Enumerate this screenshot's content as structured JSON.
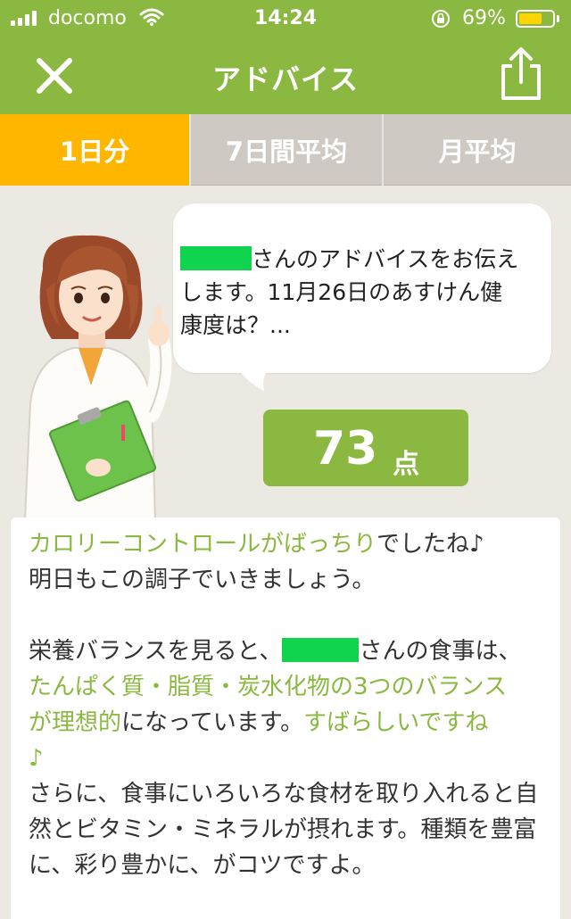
{
  "status_bar": {
    "carrier": "docomo",
    "time": "14:24",
    "battery_percent": "69%",
    "battery_level": 0.69,
    "signal_icon": "signal-bars-icon",
    "wifi_icon": "wifi-icon",
    "lock_icon": "rotation-lock-icon"
  },
  "nav": {
    "title": "アドバイス",
    "close_icon": "close-icon",
    "share_icon": "share-icon"
  },
  "tabs": [
    {
      "label": "1日分",
      "active": true
    },
    {
      "label": "7日間平均",
      "active": false
    },
    {
      "label": "月平均",
      "active": false
    }
  ],
  "bubble": {
    "line1_suffix": "さんのアドバイスをお伝え",
    "line2": "します。11月26日のあすけん健",
    "line3": "康度は？..."
  },
  "score": {
    "value": "73",
    "unit": "点"
  },
  "advice": {
    "p1_highlight": "カロリーコントロールがばっちり",
    "p1_rest": "でしたね♪",
    "p1_line2": "明日もこの調子でいきましょう。",
    "p2_start": "栄養バランスを見ると、",
    "p2_after_name": "さんの食事は、",
    "p2_highlight1": "たんぱく質・脂質・炭水化物の3つのバランス",
    "p2_highlight2": "が理想的",
    "p2_middle": "になっています。",
    "p2_highlight3": "すばらしいですね",
    "p2_note": "♪",
    "p3": "さらに、食事にいろいろな食材を取り入れると自然とビタミン・ミネラルが摂れます。種類を豊富に、彩り豊かに、がコツですよ。"
  },
  "colors": {
    "brand_green": "#8ab840",
    "tab_active": "#ffb600",
    "tab_inactive": "#cfc9c3",
    "background": "#ece9e3",
    "name_mask": "#10d44e"
  }
}
